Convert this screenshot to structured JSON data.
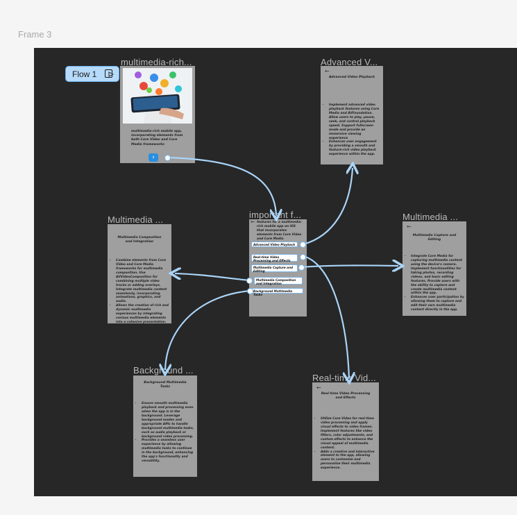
{
  "frame_label": "Frame 3",
  "flow_badge": {
    "label": "Flow 1"
  },
  "frames": {
    "home": {
      "title": "multimedia-rich...",
      "body": "multimedia-rich mobile app, incorporating elements from both Core Video and Core Media frameworks"
    },
    "advanced": {
      "title": "Advanced V...",
      "back": "←",
      "heading": "Advanced Video Playback",
      "bullets": [
        "Implement advanced video playback features using Core Media and AVFoundation. Allow users to play, pause, seek, and control playback speed. Support fullscreen mode and provide an immersive viewing experience",
        "Enhances user engagement by providing a smooth and feature-rich video playback experience within the app."
      ]
    },
    "important": {
      "title": "important f...",
      "back": "←",
      "heading": "features for a multimedia-rich mobile app on iOS that incorporates elements from Core Video and Core Media frameworks",
      "buttons": [
        "Advanced Video Playback",
        "Real-time Video Processing and Effects",
        "Multimedia Capture and Editing",
        "Multimedia Composition and Integration",
        "Background Multimedia Tasks"
      ]
    },
    "composition": {
      "title": "Multimedia ...",
      "heading": "Multimedia Composition and Integration",
      "bullets": [
        "Combine elements from Core Video and Core Media frameworks for multimedia composition. Use AVVideoComposition for combining multiple video tracks or adding overlays. Integrate multimedia content seamlessly, incorporating animations, graphics, and audio.",
        "Allows the creation of rich and dynamic multimedia experiences by integrating various multimedia elements into a cohesive presentation."
      ]
    },
    "capture": {
      "title": "Multimedia ...",
      "back": "←",
      "heading": "Multimedia Capture and Editing",
      "bullets": [
        "Integrate Core Media for capturing multimedia content using the device's camera. Implement functionalities for taking photos, recording videos, and basic editing features. Provide users with the ability to capture and create multimedia content within the app.",
        "Enhances user participation by allowing them to capture and edit their own multimedia content directly in the app."
      ]
    },
    "background": {
      "title": "Background ...",
      "heading": "Background Multimedia Tasks",
      "bullets": [
        "Ensure smooth multimedia playback and processing even when the app is in the background. Leverage background modes and appropriate APIs to handle background multimedia tasks, such as audio playback or background video processing.",
        "Provides a seamless user experience by allowing multimedia tasks to continue in the background, enhancing the app's functionality and versatility."
      ]
    },
    "realtime": {
      "title": "Real-time Vid...",
      "back": "←",
      "heading": "Real-time Video Processing and Effects",
      "bullets": [
        "Utilize Core Video for real-time video processing and apply visual effects to video frames. Implement features like video filters, color adjustments, and custom effects to enhance the visual appeal of multimedia content.",
        "Adds a creative and interactive element to the app, allowing users to customize and personalize their multimedia experience."
      ]
    }
  },
  "colors": {
    "canvas": "#272727",
    "screen": "#9f9f9f",
    "connector": "#a9d4f8",
    "badge": "#b6daf9"
  }
}
